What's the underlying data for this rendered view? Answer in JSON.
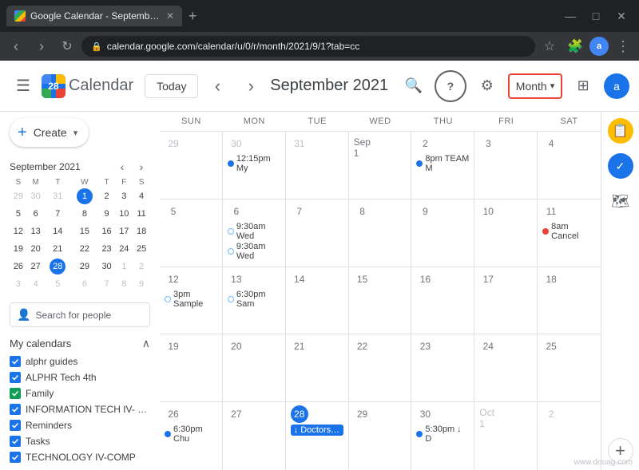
{
  "browser": {
    "tab_title": "Google Calendar - September 20...",
    "url": "calendar.google.com/calendar/u/0/r/month/2021/9/1?tab=cc",
    "new_tab_label": "+",
    "nav": {
      "back": "‹",
      "forward": "›",
      "refresh": "↻"
    },
    "window_controls": {
      "minimize": "—",
      "maximize": "□",
      "close": "✕"
    }
  },
  "header": {
    "hamburger_label": "☰",
    "logo_number": "28",
    "logo_alt": "Google Calendar logo",
    "app_name": "Calendar",
    "today_btn": "Today",
    "nav_prev": "‹",
    "nav_next": "›",
    "month_title": "September 2021",
    "search_icon": "🔍",
    "help_icon": "?",
    "settings_icon": "⚙",
    "month_view_label": "Month",
    "dropdown_arrow": "▾",
    "grid_dots": "⊞",
    "profile_initials": "a"
  },
  "sidebar": {
    "create_btn": "Create",
    "mini_calendar": {
      "title": "September 2021",
      "prev": "‹",
      "next": "›",
      "day_headers": [
        "S",
        "M",
        "T",
        "W",
        "T",
        "F",
        "S"
      ],
      "weeks": [
        [
          {
            "d": 29,
            "m": "other"
          },
          {
            "d": 30,
            "m": "other"
          },
          {
            "d": 31,
            "m": "other"
          },
          {
            "d": 1,
            "m": "cur",
            "today": true
          },
          {
            "d": 2,
            "m": "cur"
          },
          {
            "d": 3,
            "m": "cur"
          },
          {
            "d": 4,
            "m": "cur"
          }
        ],
        [
          {
            "d": 5,
            "m": "cur"
          },
          {
            "d": 6,
            "m": "cur"
          },
          {
            "d": 7,
            "m": "cur"
          },
          {
            "d": 8,
            "m": "cur"
          },
          {
            "d": 9,
            "m": "cur"
          },
          {
            "d": 10,
            "m": "cur"
          },
          {
            "d": 11,
            "m": "cur"
          }
        ],
        [
          {
            "d": 12,
            "m": "cur"
          },
          {
            "d": 13,
            "m": "cur"
          },
          {
            "d": 14,
            "m": "cur"
          },
          {
            "d": 15,
            "m": "cur"
          },
          {
            "d": 16,
            "m": "cur"
          },
          {
            "d": 17,
            "m": "cur"
          },
          {
            "d": 18,
            "m": "cur"
          }
        ],
        [
          {
            "d": 19,
            "m": "cur"
          },
          {
            "d": 20,
            "m": "cur"
          },
          {
            "d": 21,
            "m": "cur"
          },
          {
            "d": 22,
            "m": "cur"
          },
          {
            "d": 23,
            "m": "cur"
          },
          {
            "d": 24,
            "m": "cur"
          },
          {
            "d": 25,
            "m": "cur"
          }
        ],
        [
          {
            "d": 26,
            "m": "cur"
          },
          {
            "d": 27,
            "m": "cur"
          },
          {
            "d": 28,
            "m": "cur",
            "highlight": true
          },
          {
            "d": 29,
            "m": "cur"
          },
          {
            "d": 30,
            "m": "cur"
          },
          {
            "d": 1,
            "m": "other"
          },
          {
            "d": 2,
            "m": "other"
          }
        ],
        [
          {
            "d": 3,
            "m": "other"
          },
          {
            "d": 4,
            "m": "other"
          },
          {
            "d": 5,
            "m": "other"
          },
          {
            "d": 6,
            "m": "other"
          },
          {
            "d": 7,
            "m": "other"
          },
          {
            "d": 8,
            "m": "other"
          },
          {
            "d": 9,
            "m": "other"
          }
        ]
      ]
    },
    "search_people_placeholder": "Search for people",
    "my_calendars_title": "My calendars",
    "calendars": [
      {
        "name": "alphr guides",
        "color": "#1a73e8",
        "checked": true
      },
      {
        "name": "ALPHR Tech 4th",
        "color": "#1a73e8",
        "checked": true
      },
      {
        "name": "Family",
        "color": "#1a73e8",
        "checked": true
      },
      {
        "name": "INFORMATION TECH IV- C...",
        "color": "#1a73e8",
        "checked": true
      },
      {
        "name": "Reminders",
        "color": "#1a73e8",
        "checked": true
      },
      {
        "name": "Tasks",
        "color": "#1a73e8",
        "checked": true
      },
      {
        "name": "TECHNOLOGY IV-COMP",
        "color": "#1a73e8",
        "checked": true
      }
    ]
  },
  "calendar": {
    "day_headers": [
      "SUN",
      "MON",
      "TUE",
      "WED",
      "THU",
      "FRI",
      "SAT"
    ],
    "weeks": [
      {
        "cells": [
          {
            "date": 29,
            "month": "prev",
            "events": []
          },
          {
            "date": 30,
            "month": "prev",
            "events": [
              {
                "type": "dot",
                "color": "#1a73e8",
                "text": "12:15pm My"
              }
            ]
          },
          {
            "date": 31,
            "month": "prev",
            "events": []
          },
          {
            "date": 1,
            "month": "cur",
            "label": "Sep 1",
            "events": []
          },
          {
            "date": 2,
            "month": "cur",
            "events": [
              {
                "type": "dot",
                "color": "#1a73e8",
                "text": "8pm TEAM M"
              }
            ]
          },
          {
            "date": 3,
            "month": "cur",
            "events": []
          },
          {
            "date": 4,
            "month": "cur",
            "events": []
          }
        ]
      },
      {
        "cells": [
          {
            "date": 5,
            "month": "cur",
            "events": []
          },
          {
            "date": 6,
            "month": "cur",
            "events": [
              {
                "type": "dot",
                "color": "#70b8ff",
                "text": "9:30am Wed"
              },
              {
                "type": "dot",
                "color": "#70b8ff",
                "text": "9:30am Wed"
              }
            ]
          },
          {
            "date": 7,
            "month": "cur",
            "events": []
          },
          {
            "date": 8,
            "month": "cur",
            "events": []
          },
          {
            "date": 9,
            "month": "cur",
            "events": []
          },
          {
            "date": 10,
            "month": "cur",
            "events": []
          },
          {
            "date": 11,
            "month": "cur",
            "events": [
              {
                "type": "dot",
                "color": "#ea4335",
                "text": "8am Cancel"
              }
            ]
          }
        ]
      },
      {
        "cells": [
          {
            "date": 12,
            "month": "cur",
            "events": [
              {
                "type": "dot",
                "color": "#70b8ff",
                "text": "3pm Sample"
              }
            ]
          },
          {
            "date": 13,
            "month": "cur",
            "events": [
              {
                "type": "dot",
                "color": "#70b8ff",
                "text": "6:30pm Sam"
              }
            ]
          },
          {
            "date": 14,
            "month": "cur",
            "events": []
          },
          {
            "date": 15,
            "month": "cur",
            "events": []
          },
          {
            "date": 16,
            "month": "cur",
            "events": []
          },
          {
            "date": 17,
            "month": "cur",
            "events": []
          },
          {
            "date": 18,
            "month": "cur",
            "events": []
          }
        ]
      },
      {
        "cells": [
          {
            "date": 19,
            "month": "cur",
            "events": []
          },
          {
            "date": 20,
            "month": "cur",
            "events": []
          },
          {
            "date": 21,
            "month": "cur",
            "events": []
          },
          {
            "date": 22,
            "month": "cur",
            "events": []
          },
          {
            "date": 23,
            "month": "cur",
            "events": []
          },
          {
            "date": 24,
            "month": "cur",
            "events": []
          },
          {
            "date": 25,
            "month": "cur",
            "events": []
          }
        ]
      },
      {
        "cells": [
          {
            "date": 26,
            "month": "cur",
            "events": [
              {
                "type": "dot",
                "color": "#1a73e8",
                "text": "6:30pm Chu"
              }
            ]
          },
          {
            "date": 27,
            "month": "cur",
            "events": []
          },
          {
            "date": 28,
            "month": "cur",
            "today": true,
            "events": [
              {
                "type": "chip",
                "color": "#1a73e8",
                "text": "↓ Doctors App"
              }
            ]
          },
          {
            "date": 29,
            "month": "cur",
            "events": []
          },
          {
            "date": 30,
            "month": "cur",
            "events": [
              {
                "type": "dot",
                "color": "#1a73e8",
                "text": "5:30pm ↓ D"
              }
            ]
          },
          {
            "date": 1,
            "month": "next",
            "label": "Oct 1",
            "events": []
          },
          {
            "date": 2,
            "month": "next",
            "events": []
          }
        ]
      }
    ]
  },
  "right_sidebar": {
    "icons": [
      "📋",
      "✓",
      "🗺"
    ]
  },
  "watermark": "www.douag.com"
}
